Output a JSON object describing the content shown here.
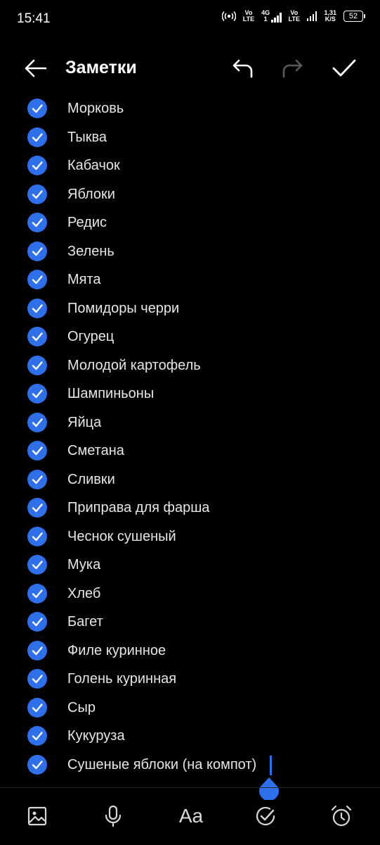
{
  "status_bar": {
    "time": "15:41",
    "net1_top": "Vo",
    "net1_bottom": "LTE",
    "net2_top": "4G",
    "net2_bottom": "1",
    "net3_top": "Vo",
    "net3_bottom": "LTE",
    "speed_top": "1,31",
    "speed_bottom": "K/S",
    "battery": "52"
  },
  "header": {
    "title": "Заметки"
  },
  "items": [
    "Морковь",
    "Тыква",
    "Кабачок",
    "Яблоки",
    "Редис",
    "Зелень",
    "Мята",
    "Помидоры черри",
    "Огурец",
    "Молодой картофель",
    "Шампиньоны",
    "Яйца",
    "Сметана",
    "Сливки",
    "Приправа для фарша",
    "Чеснок сушеный",
    "Мука",
    "Хлеб",
    "Багет",
    "Филе куринное",
    "Голень куринная",
    "Сыр",
    "Кукуруза",
    "Сушеные яблоки (на компот)"
  ],
  "toolbar": {
    "text_format_label": "Aa"
  },
  "colors": {
    "accent": "#2f6fea",
    "background": "#000000",
    "text": "#e6e6e6"
  }
}
